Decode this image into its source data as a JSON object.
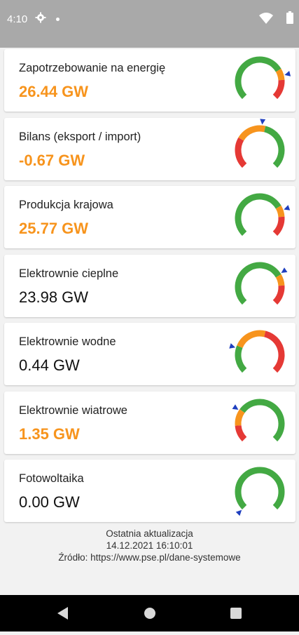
{
  "status": {
    "time": "4:10",
    "icons": [
      "gear-icon",
      "dot-icon",
      "wifi-icon",
      "battery-icon"
    ]
  },
  "colors": {
    "accent": "#f7941d",
    "gauge_green": "#43a943",
    "gauge_orange": "#f7941d",
    "gauge_red": "#e53935",
    "pointer": "#1f3fbf"
  },
  "cards": [
    {
      "label": "Zapotrzebowanie na energię",
      "value": "26.44 GW",
      "highlight": true,
      "gauge": [
        [
          "green",
          0.0,
          0.72
        ],
        [
          "orange",
          0.72,
          0.82
        ],
        [
          "red",
          0.82,
          1.0
        ]
      ],
      "pointer_level": 0.78
    },
    {
      "label": "Bilans (eksport / import)",
      "value": "-0.67 GW",
      "highlight": true,
      "gauge": [
        [
          "red",
          0.0,
          0.28
        ],
        [
          "orange",
          0.28,
          0.55
        ],
        [
          "green",
          0.55,
          1.0
        ]
      ],
      "pointer_level": 0.52
    },
    {
      "label": "Produkcja krajowa",
      "value": "25.77 GW",
      "highlight": true,
      "gauge": [
        [
          "green",
          0.0,
          0.72
        ],
        [
          "orange",
          0.72,
          0.82
        ],
        [
          "red",
          0.82,
          1.0
        ]
      ],
      "pointer_level": 0.76
    },
    {
      "label": "Elektrownie cieplne",
      "value": "23.98 GW",
      "highlight": false,
      "gauge": [
        [
          "green",
          0.0,
          0.72
        ],
        [
          "orange",
          0.72,
          0.82
        ],
        [
          "red",
          0.82,
          1.0
        ]
      ],
      "pointer_level": 0.71
    },
    {
      "label": "Elektrownie wodne",
      "value": "0.44 GW",
      "highlight": false,
      "gauge": [
        [
          "green",
          0.0,
          0.25
        ],
        [
          "orange",
          0.25,
          0.55
        ],
        [
          "red",
          0.55,
          1.0
        ]
      ],
      "pointer_level": 0.23
    },
    {
      "label": "Elektrownie wiatrowe",
      "value": "1.35 GW",
      "highlight": true,
      "gauge": [
        [
          "red",
          0.0,
          0.15
        ],
        [
          "orange",
          0.15,
          0.3
        ],
        [
          "green",
          0.3,
          1.0
        ]
      ],
      "pointer_level": 0.29
    },
    {
      "label": "Fotowoltaika",
      "value": "0.00 GW",
      "highlight": false,
      "gauge": [
        [
          "green",
          0.0,
          1.0
        ]
      ],
      "pointer_level": 0.0
    }
  ],
  "footer": {
    "updated_label": "Ostatnia aktualizacja",
    "updated_at": "14.12.2021 16:10:01",
    "source": "Źródło: https://www.pse.pl/dane-systemowe"
  },
  "navigation": {
    "icons": [
      "back-icon",
      "home-icon",
      "recents-icon"
    ]
  }
}
